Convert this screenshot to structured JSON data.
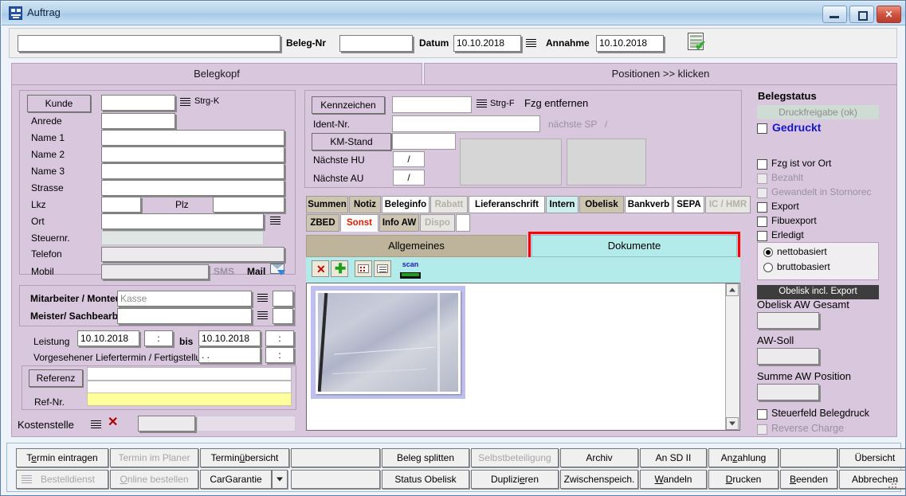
{
  "window": {
    "title": "Auftrag",
    "icon": "app-icon",
    "minimize": "minimize-icon",
    "maximize": "maximize-icon",
    "close": "close-icon"
  },
  "topbar": {
    "main_field": "",
    "beleg_nr_label": "Beleg-Nr",
    "beleg_nr_value": "",
    "datum_label": "Datum",
    "datum_value": "10.10.2018",
    "datum_menu_icon": "list-menu-icon",
    "annahme_label": "Annahme",
    "annahme_value": "10.10.2018",
    "calc_icon": "calculator-check-icon"
  },
  "main_tabs": [
    {
      "label": "Belegkopf",
      "selected": true
    },
    {
      "label": "Positionen >> klicken",
      "selected": false
    }
  ],
  "customer": {
    "kunde_label": "Kunde",
    "kunde_value": "",
    "kunde_hint": "Strg-K",
    "kunde_menu_icon": "list-menu-icon",
    "anrede_label": "Anrede",
    "anrede_value": "",
    "name1_label": "Name 1",
    "name1_value": "",
    "name2_label": "Name 2",
    "name2_value": "",
    "name3_label": "Name 3",
    "name3_value": "",
    "strasse_label": "Strasse",
    "strasse_value": "",
    "lkz_label": "Lkz",
    "lkz_value": "",
    "plz_label": "Plz",
    "plz_value": "",
    "ort_label": "Ort",
    "ort_value": "",
    "ort_menu_icon": "list-menu-icon",
    "steuernr_label": "Steuernr.",
    "steuernr_value": "",
    "telefon_label": "Telefon",
    "telefon_value": "",
    "mobil_label": "Mobil",
    "mobil_value": "",
    "sms_label": "SMS",
    "mail_label": "Mail",
    "mail_icon": "mail-icon"
  },
  "staff": {
    "mitarbeiter_label": "Mitarbeiter / Monteur",
    "mitarbeiter_value": "Kasse",
    "mitarbeiter_menu_icon": "list-menu-icon",
    "mitarbeiter_code": "",
    "meister_label": "Meister/ Sachbearb.",
    "meister_value": "",
    "meister_menu_icon": "list-menu-icon",
    "meister_code": ""
  },
  "service": {
    "leistung_label": "Leistung",
    "leistung_from": "10.10.2018",
    "leistung_from_time": ":",
    "bis_label": "bis",
    "leistung_to": "10.10.2018",
    "leistung_to_time": ":",
    "liefertermin_label": "Vorgesehener Liefertermin / Fertigstellung",
    "liefertermin_value": ".  .",
    "liefertermin_time": ":",
    "referenz_label": "Referenz",
    "referenz_value": "",
    "refnr_label": "Ref-Nr.",
    "refnr_value": "",
    "kostenstelle_label": "Kostenstelle",
    "kostenstelle_menu_icon": "list-menu-icon",
    "kostenstelle_clear_icon": "clear-x-icon",
    "kostenstelle_value": ""
  },
  "vehicle": {
    "kennzeichen_label": "Kennzeichen",
    "kennzeichen_value": "",
    "kennzeichen_hint": "Strg-F",
    "kennzeichen_menu_icon": "list-menu-icon",
    "fzg_entfernen_label": "Fzg entfernen",
    "ident_label": "Ident-Nr.",
    "ident_value": "",
    "naechste_sp_label": "nächste SP",
    "naechste_sp_sep": "/",
    "km_label": "KM-Stand",
    "km_value": "",
    "hu_label": "Nächste HU",
    "hu_value": "/",
    "au_label": "Nächste AU",
    "au_value": "/"
  },
  "subtabs_row1": [
    {
      "label": "Summen",
      "style": "beige",
      "disabled": false
    },
    {
      "label": "Notiz",
      "style": "beige",
      "disabled": false
    },
    {
      "label": "Beleginfo",
      "style": "white",
      "disabled": false
    },
    {
      "label": "Rabatt",
      "style": "white",
      "disabled": true
    },
    {
      "label": "Lieferanschrift",
      "style": "white",
      "disabled": false
    },
    {
      "label": "Intern",
      "style": "cyan",
      "disabled": false
    },
    {
      "label": "Obelisk",
      "style": "beige",
      "disabled": false
    },
    {
      "label": "Bankverb",
      "style": "white",
      "disabled": false
    },
    {
      "label": "SEPA",
      "style": "white",
      "disabled": false
    },
    {
      "label": "IC / HMR",
      "style": "white",
      "disabled": true
    }
  ],
  "subtabs_row2": [
    {
      "label": "ZBED",
      "style": "beige",
      "disabled": false,
      "selected": false
    },
    {
      "label": "Sonst",
      "style": "white",
      "disabled": false,
      "selected": true
    },
    {
      "label": "Info AW",
      "style": "beige",
      "disabled": false,
      "selected": false
    },
    {
      "label": "Dispo",
      "style": "white",
      "disabled": true,
      "selected": false
    }
  ],
  "doc_section": {
    "allgemeines_label": "Allgemeines",
    "dokumente_label": "Dokumente",
    "highlight_color": "#ff0000",
    "toolbar": [
      {
        "icon": "delete-document-icon"
      },
      {
        "icon": "add-document-icon"
      },
      {
        "icon": "thumbnail-view-icon"
      },
      {
        "icon": "list-view-icon"
      },
      {
        "icon": "scan-icon"
      }
    ],
    "thumbnail": {
      "name": "document-thumbnail",
      "selected": true
    },
    "scroll_up_icon": "scroll-up-icon",
    "scroll_down_icon": "scroll-down-icon"
  },
  "status": {
    "title": "Belegstatus",
    "druckfreigabe_label": "Druckfreigabe (ok)",
    "gedruckt_label": "Gedruckt",
    "gedruckt_checked": false,
    "gedruckt_color": "#1616cf",
    "checkboxes": [
      {
        "label": "Fzg ist vor Ort",
        "checked": false,
        "disabled": false
      },
      {
        "label": "Bezahlt",
        "checked": false,
        "disabled": true
      },
      {
        "label": "Gewandelt in Stornorec",
        "checked": false,
        "disabled": true
      },
      {
        "label": "Export",
        "checked": false,
        "disabled": false
      },
      {
        "label": "Fibuexport",
        "checked": false,
        "disabled": false
      },
      {
        "label": "Erledigt",
        "checked": false,
        "disabled": false
      }
    ],
    "radios": [
      {
        "label": "nettobasiert",
        "selected": true
      },
      {
        "label": "bruttobasiert",
        "selected": false
      }
    ],
    "obelisk_bar": "Obelisk incl. Export",
    "fields": [
      {
        "label": "Obelisk AW Gesamt",
        "value": ""
      },
      {
        "label": "AW-Soll",
        "value": ""
      },
      {
        "label": "Summe AW Position",
        "value": ""
      }
    ],
    "bottom_checkboxes": [
      {
        "label": "Steuerfeld Belegdruck",
        "checked": false,
        "disabled": false
      },
      {
        "label": "Reverse Charge",
        "checked": false,
        "disabled": true
      }
    ]
  },
  "buttons_row1": [
    {
      "label": "Termin eintragen",
      "disabled": false,
      "accel": 1
    },
    {
      "label": "Termin im Planer",
      "disabled": true,
      "accel": -1
    },
    {
      "label": "Terminübersicht",
      "disabled": false,
      "accel": 6
    },
    {
      "label": "",
      "disabled": true,
      "accel": -1
    },
    {
      "label": "Beleg splitten",
      "disabled": false,
      "accel": -1
    },
    {
      "label": "Selbstbeteiligung",
      "disabled": true,
      "accel": -1
    },
    {
      "label": "Archiv",
      "disabled": false,
      "accel": -1
    },
    {
      "label": "An SD II",
      "disabled": false,
      "accel": -1
    },
    {
      "label": "Anzahlung",
      "disabled": false,
      "accel": 2
    },
    {
      "label": "",
      "disabled": false,
      "accel": -1
    },
    {
      "label": "Übersicht",
      "disabled": false,
      "accel": -1
    }
  ],
  "buttons_row2": [
    {
      "label": "Bestelldienst",
      "disabled": true,
      "accel": -1,
      "icon": "list-menu-icon"
    },
    {
      "label": "Online bestellen",
      "disabled": true,
      "accel": 0
    },
    {
      "label": "CarGarantie",
      "disabled": false,
      "accel": -1,
      "dropdown": true
    },
    {
      "label": "",
      "disabled": false,
      "accel": -1
    },
    {
      "label": "Status Obelisk",
      "disabled": false,
      "accel": -1
    },
    {
      "label": "Duplizieren",
      "disabled": false,
      "accel": 7
    },
    {
      "label": "Zwischenspeich.",
      "disabled": false,
      "accel": -1
    },
    {
      "label": "Wandeln",
      "disabled": false,
      "accel": 0
    },
    {
      "label": "Drucken",
      "disabled": false,
      "accel": 0
    },
    {
      "label": "Beenden",
      "disabled": false,
      "accel": 0
    },
    {
      "label": "Abbrechen",
      "disabled": false,
      "accel": -1
    }
  ]
}
